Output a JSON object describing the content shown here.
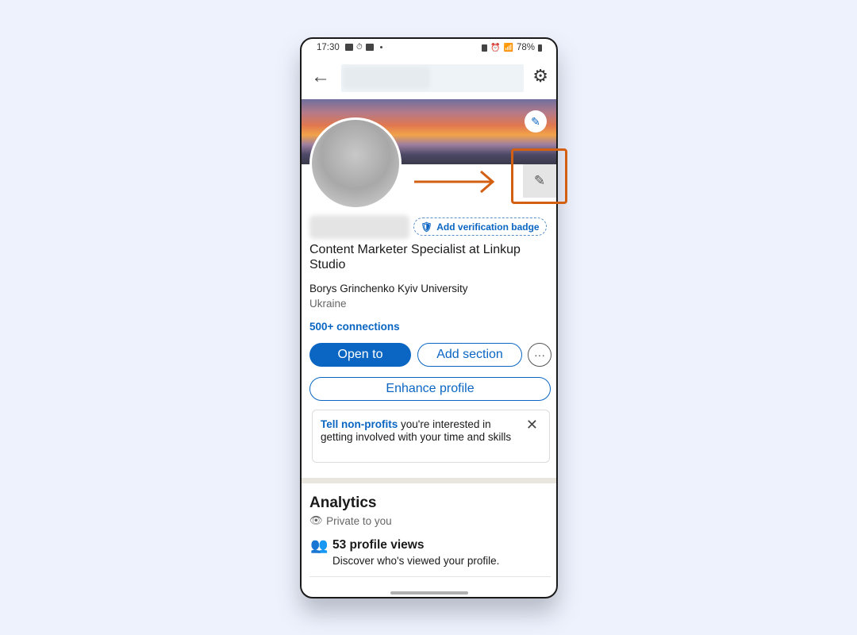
{
  "status_bar": {
    "time": "17:30",
    "battery": "78%"
  },
  "topbar": {
    "back_icon": "arrow-left-icon",
    "search_placeholder_blurred": true,
    "settings_icon": "gear-icon"
  },
  "profile": {
    "verification_badge": "Add verification badge",
    "headline": "Content Marketer Specialist at Linkup Studio",
    "education": "Borys Grinchenko Kyiv University",
    "location": "Ukraine",
    "connections": "500+ connections"
  },
  "actions": {
    "open_to": "Open to",
    "add_section": "Add section",
    "more": "···",
    "enhance": "Enhance profile"
  },
  "nonprofit_card": {
    "highlight": "Tell non-profits",
    "text": " you're interested in getting involved with your time and skills",
    "close": "✕"
  },
  "analytics": {
    "title": "Analytics",
    "privacy": "Private to you",
    "views": "53 profile views",
    "views_desc": "Discover who's viewed your profile."
  },
  "colors": {
    "accent": "#0a66c2",
    "annotation": "#d35f12"
  }
}
